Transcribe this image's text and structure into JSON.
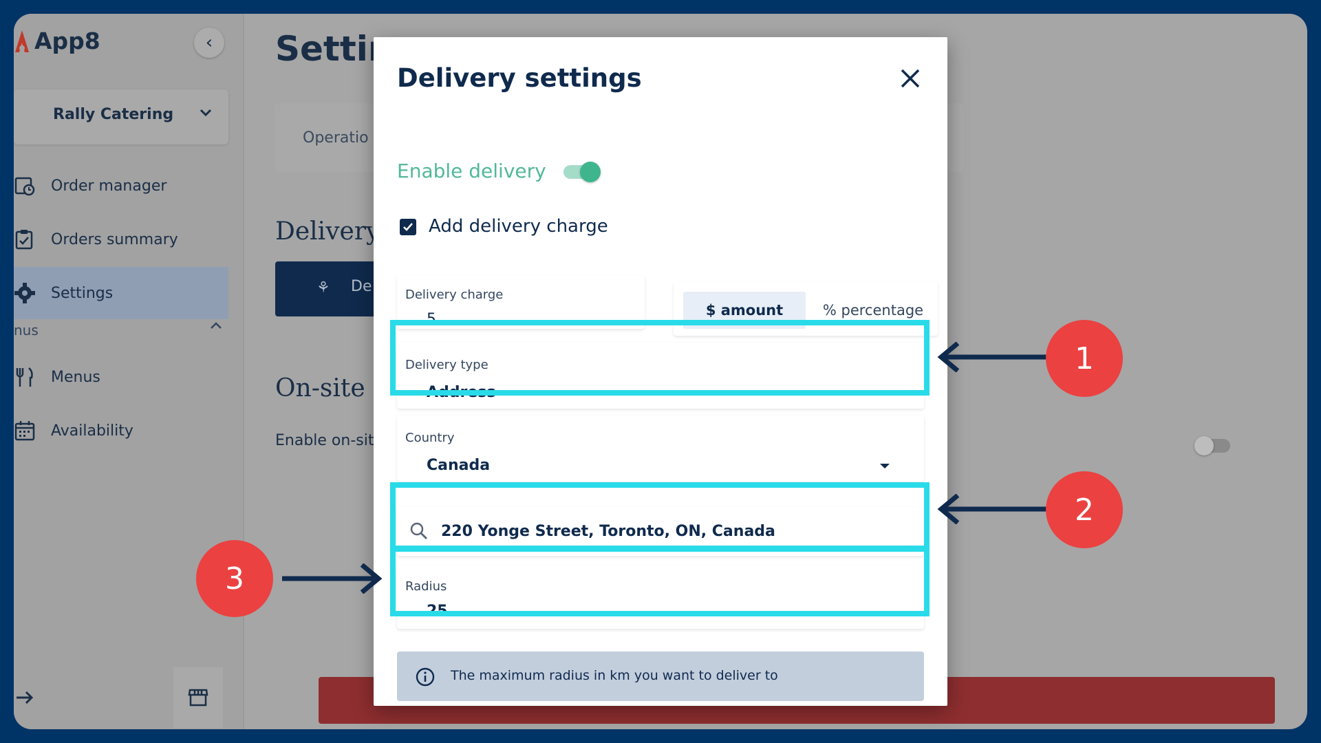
{
  "app": {
    "name": "App8",
    "store": "Rally Catering"
  },
  "sidebar": {
    "items": [
      {
        "label": "Order manager",
        "icon": "order-manager-icon"
      },
      {
        "label": "Orders summary",
        "icon": "clipboard-check-icon"
      },
      {
        "label": "Settings",
        "icon": "gear-icon",
        "active": true
      },
      {
        "label": "Menus",
        "icon": "fork-knife-icon"
      },
      {
        "label": "Availability",
        "icon": "calendar-icon"
      }
    ],
    "section_label": "nus"
  },
  "page": {
    "title": "Settin",
    "tab_operations": "Operatio",
    "section_delivery": "Delivery",
    "delivery_button": "De",
    "section_onsite": "On-site c",
    "onsite_label": "Enable on-site"
  },
  "modal": {
    "title": "Delivery settings",
    "enable_delivery_label": "Enable delivery",
    "enable_delivery_on": true,
    "add_charge_label": "Add delivery charge",
    "add_charge_checked": true,
    "delivery_charge": {
      "label": "Delivery charge",
      "value": "5"
    },
    "charge_options": {
      "amount": "$ amount",
      "percentage": "% percentage",
      "selected": "amount"
    },
    "delivery_type": {
      "label": "Delivery type",
      "value": "Address"
    },
    "country": {
      "label": "Country",
      "value": "Canada"
    },
    "address": {
      "value": "220 Yonge Street, Toronto, ON, Canada"
    },
    "radius": {
      "label": "Radius",
      "value": "25"
    },
    "info_text": "The maximum radius in km you want to deliver to"
  },
  "annotations": {
    "badge_1": "1",
    "badge_2": "2",
    "badge_3": "3"
  },
  "colors": {
    "highlight": "#29dbe8",
    "badge": "#eb4141",
    "accent_green": "#3fb58e",
    "navy": "#0f2a4d"
  }
}
